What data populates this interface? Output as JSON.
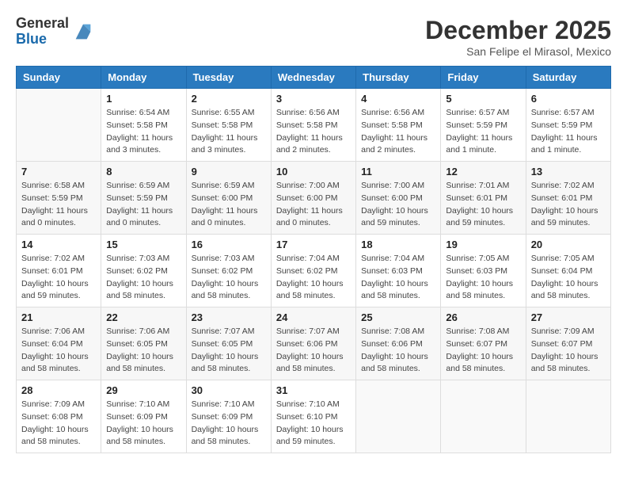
{
  "header": {
    "logo_general": "General",
    "logo_blue": "Blue",
    "month_title": "December 2025",
    "subtitle": "San Felipe el Mirasol, Mexico"
  },
  "calendar": {
    "days_of_week": [
      "Sunday",
      "Monday",
      "Tuesday",
      "Wednesday",
      "Thursday",
      "Friday",
      "Saturday"
    ],
    "weeks": [
      [
        {
          "day": "",
          "sunrise": "",
          "sunset": "",
          "daylight": "",
          "empty": true
        },
        {
          "day": "1",
          "sunrise": "Sunrise: 6:54 AM",
          "sunset": "Sunset: 5:58 PM",
          "daylight": "Daylight: 11 hours and 3 minutes.",
          "empty": false
        },
        {
          "day": "2",
          "sunrise": "Sunrise: 6:55 AM",
          "sunset": "Sunset: 5:58 PM",
          "daylight": "Daylight: 11 hours and 3 minutes.",
          "empty": false
        },
        {
          "day": "3",
          "sunrise": "Sunrise: 6:56 AM",
          "sunset": "Sunset: 5:58 PM",
          "daylight": "Daylight: 11 hours and 2 minutes.",
          "empty": false
        },
        {
          "day": "4",
          "sunrise": "Sunrise: 6:56 AM",
          "sunset": "Sunset: 5:58 PM",
          "daylight": "Daylight: 11 hours and 2 minutes.",
          "empty": false
        },
        {
          "day": "5",
          "sunrise": "Sunrise: 6:57 AM",
          "sunset": "Sunset: 5:59 PM",
          "daylight": "Daylight: 11 hours and 1 minute.",
          "empty": false
        },
        {
          "day": "6",
          "sunrise": "Sunrise: 6:57 AM",
          "sunset": "Sunset: 5:59 PM",
          "daylight": "Daylight: 11 hours and 1 minute.",
          "empty": false
        }
      ],
      [
        {
          "day": "7",
          "sunrise": "Sunrise: 6:58 AM",
          "sunset": "Sunset: 5:59 PM",
          "daylight": "Daylight: 11 hours and 0 minutes.",
          "empty": false
        },
        {
          "day": "8",
          "sunrise": "Sunrise: 6:59 AM",
          "sunset": "Sunset: 5:59 PM",
          "daylight": "Daylight: 11 hours and 0 minutes.",
          "empty": false
        },
        {
          "day": "9",
          "sunrise": "Sunrise: 6:59 AM",
          "sunset": "Sunset: 6:00 PM",
          "daylight": "Daylight: 11 hours and 0 minutes.",
          "empty": false
        },
        {
          "day": "10",
          "sunrise": "Sunrise: 7:00 AM",
          "sunset": "Sunset: 6:00 PM",
          "daylight": "Daylight: 11 hours and 0 minutes.",
          "empty": false
        },
        {
          "day": "11",
          "sunrise": "Sunrise: 7:00 AM",
          "sunset": "Sunset: 6:00 PM",
          "daylight": "Daylight: 10 hours and 59 minutes.",
          "empty": false
        },
        {
          "day": "12",
          "sunrise": "Sunrise: 7:01 AM",
          "sunset": "Sunset: 6:01 PM",
          "daylight": "Daylight: 10 hours and 59 minutes.",
          "empty": false
        },
        {
          "day": "13",
          "sunrise": "Sunrise: 7:02 AM",
          "sunset": "Sunset: 6:01 PM",
          "daylight": "Daylight: 10 hours and 59 minutes.",
          "empty": false
        }
      ],
      [
        {
          "day": "14",
          "sunrise": "Sunrise: 7:02 AM",
          "sunset": "Sunset: 6:01 PM",
          "daylight": "Daylight: 10 hours and 59 minutes.",
          "empty": false
        },
        {
          "day": "15",
          "sunrise": "Sunrise: 7:03 AM",
          "sunset": "Sunset: 6:02 PM",
          "daylight": "Daylight: 10 hours and 58 minutes.",
          "empty": false
        },
        {
          "day": "16",
          "sunrise": "Sunrise: 7:03 AM",
          "sunset": "Sunset: 6:02 PM",
          "daylight": "Daylight: 10 hours and 58 minutes.",
          "empty": false
        },
        {
          "day": "17",
          "sunrise": "Sunrise: 7:04 AM",
          "sunset": "Sunset: 6:02 PM",
          "daylight": "Daylight: 10 hours and 58 minutes.",
          "empty": false
        },
        {
          "day": "18",
          "sunrise": "Sunrise: 7:04 AM",
          "sunset": "Sunset: 6:03 PM",
          "daylight": "Daylight: 10 hours and 58 minutes.",
          "empty": false
        },
        {
          "day": "19",
          "sunrise": "Sunrise: 7:05 AM",
          "sunset": "Sunset: 6:03 PM",
          "daylight": "Daylight: 10 hours and 58 minutes.",
          "empty": false
        },
        {
          "day": "20",
          "sunrise": "Sunrise: 7:05 AM",
          "sunset": "Sunset: 6:04 PM",
          "daylight": "Daylight: 10 hours and 58 minutes.",
          "empty": false
        }
      ],
      [
        {
          "day": "21",
          "sunrise": "Sunrise: 7:06 AM",
          "sunset": "Sunset: 6:04 PM",
          "daylight": "Daylight: 10 hours and 58 minutes.",
          "empty": false
        },
        {
          "day": "22",
          "sunrise": "Sunrise: 7:06 AM",
          "sunset": "Sunset: 6:05 PM",
          "daylight": "Daylight: 10 hours and 58 minutes.",
          "empty": false
        },
        {
          "day": "23",
          "sunrise": "Sunrise: 7:07 AM",
          "sunset": "Sunset: 6:05 PM",
          "daylight": "Daylight: 10 hours and 58 minutes.",
          "empty": false
        },
        {
          "day": "24",
          "sunrise": "Sunrise: 7:07 AM",
          "sunset": "Sunset: 6:06 PM",
          "daylight": "Daylight: 10 hours and 58 minutes.",
          "empty": false
        },
        {
          "day": "25",
          "sunrise": "Sunrise: 7:08 AM",
          "sunset": "Sunset: 6:06 PM",
          "daylight": "Daylight: 10 hours and 58 minutes.",
          "empty": false
        },
        {
          "day": "26",
          "sunrise": "Sunrise: 7:08 AM",
          "sunset": "Sunset: 6:07 PM",
          "daylight": "Daylight: 10 hours and 58 minutes.",
          "empty": false
        },
        {
          "day": "27",
          "sunrise": "Sunrise: 7:09 AM",
          "sunset": "Sunset: 6:07 PM",
          "daylight": "Daylight: 10 hours and 58 minutes.",
          "empty": false
        }
      ],
      [
        {
          "day": "28",
          "sunrise": "Sunrise: 7:09 AM",
          "sunset": "Sunset: 6:08 PM",
          "daylight": "Daylight: 10 hours and 58 minutes.",
          "empty": false
        },
        {
          "day": "29",
          "sunrise": "Sunrise: 7:10 AM",
          "sunset": "Sunset: 6:09 PM",
          "daylight": "Daylight: 10 hours and 58 minutes.",
          "empty": false
        },
        {
          "day": "30",
          "sunrise": "Sunrise: 7:10 AM",
          "sunset": "Sunset: 6:09 PM",
          "daylight": "Daylight: 10 hours and 58 minutes.",
          "empty": false
        },
        {
          "day": "31",
          "sunrise": "Sunrise: 7:10 AM",
          "sunset": "Sunset: 6:10 PM",
          "daylight": "Daylight: 10 hours and 59 minutes.",
          "empty": false
        },
        {
          "day": "",
          "sunrise": "",
          "sunset": "",
          "daylight": "",
          "empty": true
        },
        {
          "day": "",
          "sunrise": "",
          "sunset": "",
          "daylight": "",
          "empty": true
        },
        {
          "day": "",
          "sunrise": "",
          "sunset": "",
          "daylight": "",
          "empty": true
        }
      ]
    ]
  }
}
